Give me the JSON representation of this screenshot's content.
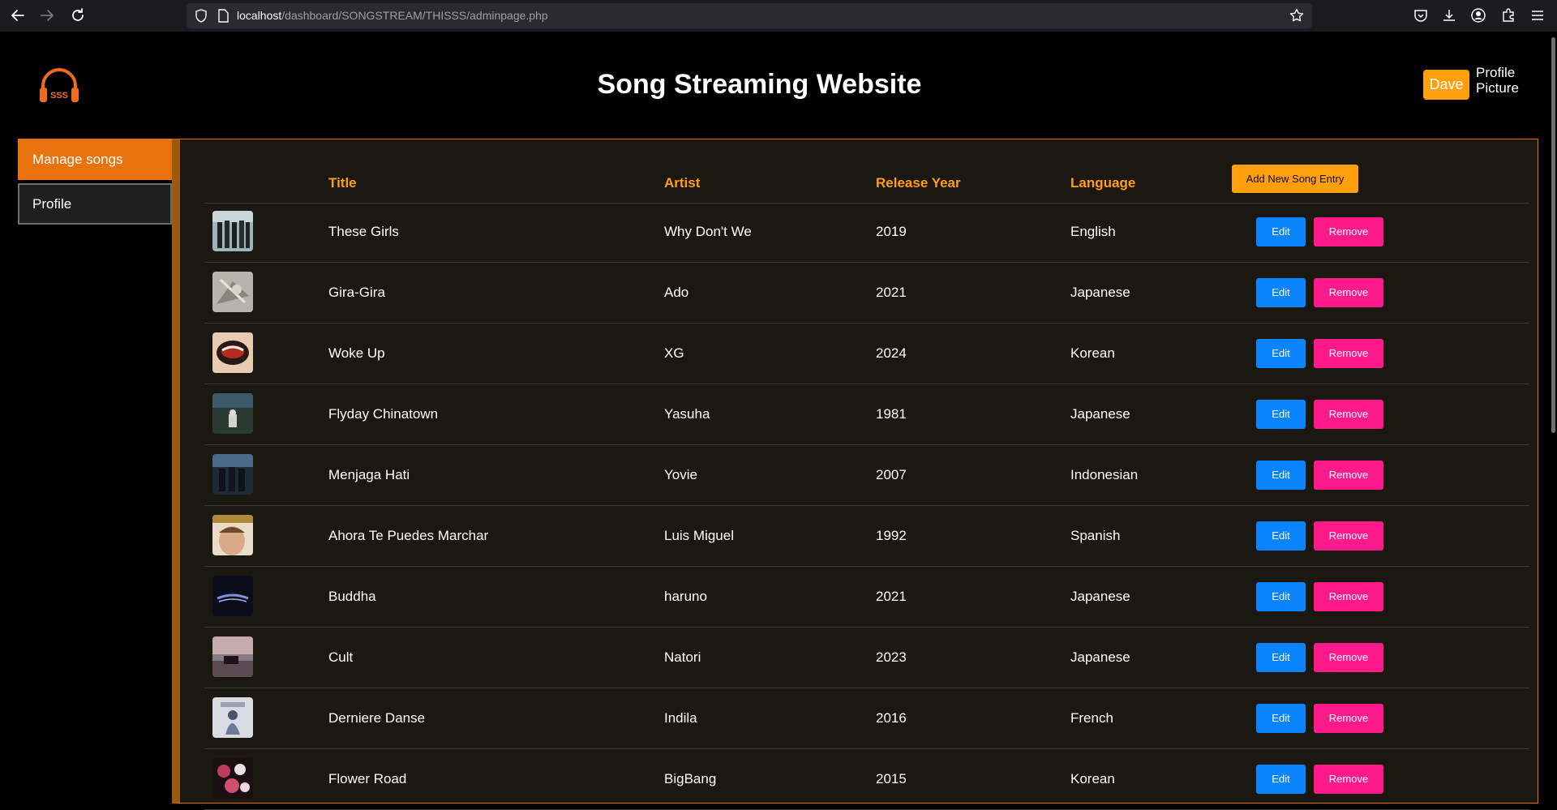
{
  "browser": {
    "url_host": "localhost",
    "url_path": "/dashboard/SONGSTREAM/THISSS/adminpage.php"
  },
  "header": {
    "title": "Song Streaming Website",
    "logo_text": "SSS",
    "user_button": "Dave",
    "profile_picture_alt": "Profile Picture"
  },
  "sidebar": {
    "items": [
      {
        "label": "Manage songs",
        "active": true
      },
      {
        "label": "Profile",
        "active": false
      }
    ]
  },
  "table": {
    "headers": {
      "title": "Title",
      "artist": "Artist",
      "year": "Release Year",
      "language": "Language"
    },
    "add_button": "Add New Song Entry",
    "edit_label": "Edit",
    "remove_label": "Remove",
    "rows": [
      {
        "title": "These Girls",
        "artist": "Why Don't We",
        "year": "2019",
        "language": "English"
      },
      {
        "title": "Gira-Gira",
        "artist": "Ado",
        "year": "2021",
        "language": "Japanese"
      },
      {
        "title": "Woke Up",
        "artist": "XG",
        "year": "2024",
        "language": "Korean"
      },
      {
        "title": "Flyday Chinatown",
        "artist": "Yasuha",
        "year": "1981",
        "language": "Japanese"
      },
      {
        "title": "Menjaga Hati",
        "artist": "Yovie",
        "year": "2007",
        "language": "Indonesian"
      },
      {
        "title": "Ahora Te Puedes Marchar",
        "artist": "Luis Miguel",
        "year": "1992",
        "language": "Spanish"
      },
      {
        "title": "Buddha",
        "artist": "haruno",
        "year": "2021",
        "language": "Japanese"
      },
      {
        "title": "Cult",
        "artist": "Natori",
        "year": "2023",
        "language": "Japanese"
      },
      {
        "title": "Derniere Danse",
        "artist": "Indila",
        "year": "2016",
        "language": "French"
      },
      {
        "title": "Flower Road",
        "artist": "BigBang",
        "year": "2015",
        "language": "Korean"
      }
    ]
  },
  "colors": {
    "accent_orange": "#ff9f0d",
    "sidebar_active": "#e8720e",
    "edit_blue": "#0a84ff",
    "remove_pink": "#ff1a8c",
    "panel_bg": "#1b1711"
  }
}
